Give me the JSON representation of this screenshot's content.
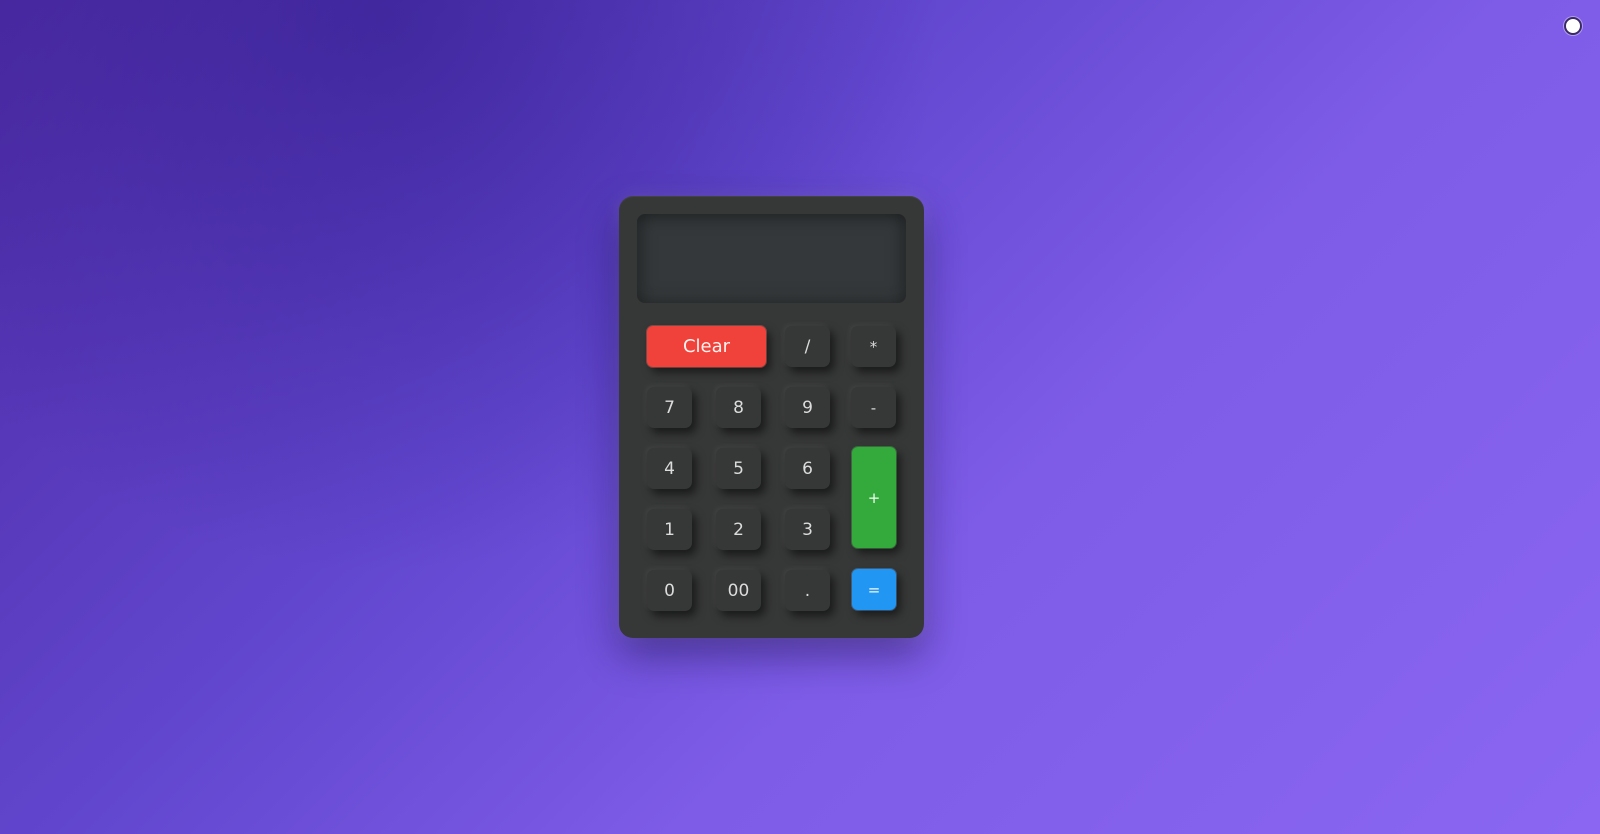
{
  "calculator": {
    "display_value": "",
    "keys": {
      "clear": "Clear",
      "divide": "/",
      "multiply": "*",
      "seven": "7",
      "eight": "8",
      "nine": "9",
      "minus": "-",
      "four": "4",
      "five": "5",
      "six": "6",
      "plus": "+",
      "one": "1",
      "two": "2",
      "three": "3",
      "zero": "0",
      "double_zero": "00",
      "decimal": ".",
      "equals": "="
    }
  },
  "colors": {
    "background_start": "#4c2aa3",
    "background_end": "#8a66f2",
    "calculator_body": "#363737",
    "clear_key": "#f0413a",
    "plus_key": "#33aa3b",
    "equals_key": "#2196f3"
  }
}
